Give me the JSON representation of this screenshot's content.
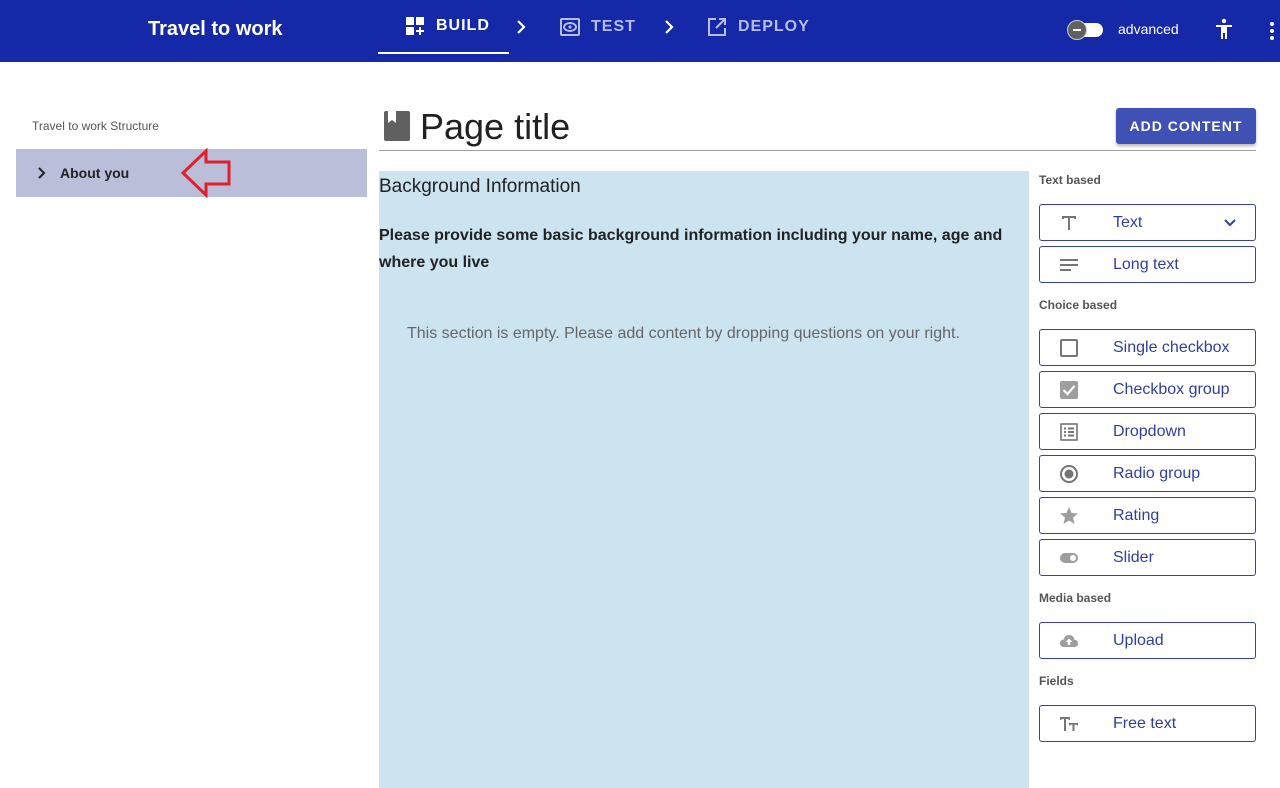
{
  "header": {
    "app_title": "Travel to work",
    "steps": [
      {
        "label": "BUILD",
        "icon": "build-icon"
      },
      {
        "label": "TEST",
        "icon": "test-icon"
      },
      {
        "label": "DEPLOY",
        "icon": "deploy-icon"
      }
    ],
    "mode_label": "advanced"
  },
  "structure": {
    "title": "Travel to work Structure",
    "items": [
      {
        "label": "About you"
      }
    ]
  },
  "page": {
    "title": "Page title",
    "add_button": "ADD CONTENT"
  },
  "section": {
    "title": "Background Information",
    "description": "Please provide some basic background information including your name, age and where you live",
    "empty_message": "This section is empty. Please add content by dropping questions on your right."
  },
  "palette": {
    "groups": [
      {
        "label": "Text based",
        "items": [
          {
            "label": "Text",
            "icon": "text-icon"
          },
          {
            "label": "Long text",
            "icon": "long-text-icon"
          }
        ]
      },
      {
        "label": "Choice based",
        "items": [
          {
            "label": "Single checkbox",
            "icon": "checkbox-icon"
          },
          {
            "label": "Checkbox group",
            "icon": "checkbox-checked-icon"
          },
          {
            "label": "Dropdown",
            "icon": "list-icon"
          },
          {
            "label": "Radio group",
            "icon": "radio-icon"
          },
          {
            "label": "Rating",
            "icon": "star-icon"
          },
          {
            "label": "Slider",
            "icon": "toggle-icon"
          }
        ]
      },
      {
        "label": "Media based",
        "items": [
          {
            "label": "Upload",
            "icon": "cloud-upload-icon"
          }
        ]
      },
      {
        "label": "Fields",
        "items": [
          {
            "label": "Free text",
            "icon": "text-fields-icon"
          }
        ]
      }
    ]
  },
  "colors": {
    "header_bg": "#1428a8",
    "accent": "#3f51b5",
    "section_bg": "#cce3f0",
    "selected_item_bg": "#babed9",
    "annotation_arrow": "#e0202a"
  }
}
